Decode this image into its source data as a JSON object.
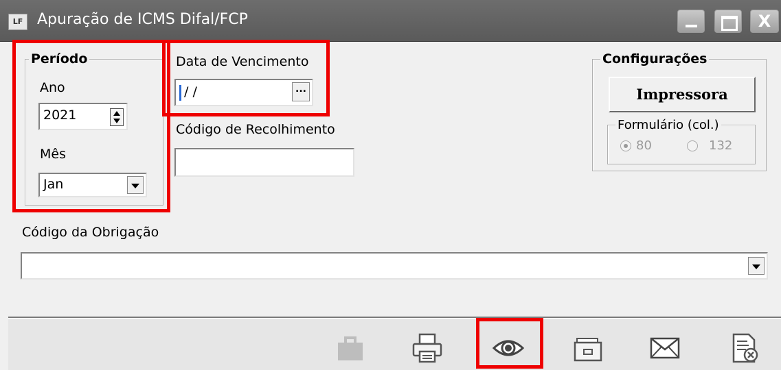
{
  "window": {
    "app_icon_text": "LF",
    "title": "Apuração de ICMS Difal/FCP",
    "close_glyph": "X"
  },
  "periodo": {
    "legend": "Período",
    "ano_label": "Ano",
    "ano_value": "2021",
    "mes_label": "Mês",
    "mes_value": "Jan"
  },
  "vencimento": {
    "label": "Data de Vencimento",
    "value": "/ /",
    "button_label": "..."
  },
  "recolhimento": {
    "label": "Código de Recolhimento",
    "value": ""
  },
  "obrigacao": {
    "label": "Código da Obrigação",
    "value": ""
  },
  "configuracoes": {
    "legend": "Configurações",
    "printer_button": "Impressora",
    "formulario_legend": "Formulário (col.)",
    "options": [
      {
        "label": "80",
        "checked": true
      },
      {
        "label": "132",
        "checked": false
      }
    ]
  },
  "toolbar": {
    "icons": [
      "briefcase-icon",
      "printer-icon",
      "eye-icon",
      "folder-icon",
      "envelope-icon",
      "close-document-icon"
    ]
  },
  "colors": {
    "highlight": "#e00000",
    "titlebar": "#5f5f5f"
  }
}
